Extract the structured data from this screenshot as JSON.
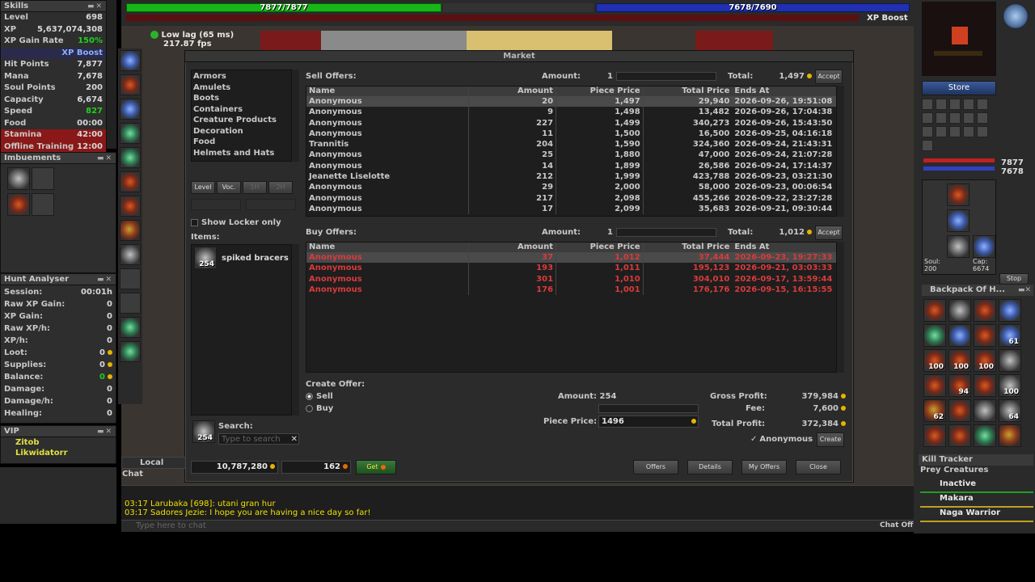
{
  "health_bar": {
    "text": "7877/7877",
    "fill": 1.0
  },
  "mana_bar": {
    "text": "7678/7690",
    "fill": 0.998
  },
  "xp_boost": "XP Boost",
  "lag": {
    "text": "Low lag (65 ms)",
    "fps": "217.87 fps"
  },
  "skills": {
    "title": "Skills",
    "rows": [
      {
        "k": "Level",
        "v": "698"
      },
      {
        "k": "XP",
        "v": "5,637,074,308"
      },
      {
        "k": "XP Gain Rate",
        "v": "150%"
      },
      {
        "k": "",
        "v": "XP Boost"
      },
      {
        "k": "Hit Points",
        "v": "7,877"
      },
      {
        "k": "Mana",
        "v": "7,678"
      },
      {
        "k": "Soul Points",
        "v": "200"
      },
      {
        "k": "Capacity",
        "v": "6,674"
      },
      {
        "k": "Speed",
        "v": "827"
      },
      {
        "k": "Food",
        "v": "00:00"
      },
      {
        "k": "Stamina",
        "v": "42:00"
      },
      {
        "k": "Offline Training",
        "v": "12:00"
      }
    ]
  },
  "imbuements": {
    "title": "Imbuements"
  },
  "hunt": {
    "title": "Hunt Analyser",
    "rows": [
      {
        "k": "Session:",
        "v": "00:01h"
      },
      {
        "k": "Raw XP Gain:",
        "v": "0"
      },
      {
        "k": "XP Gain:",
        "v": "0"
      },
      {
        "k": "Raw XP/h:",
        "v": "0"
      },
      {
        "k": "XP/h:",
        "v": "0"
      },
      {
        "k": "Loot:",
        "v": "0"
      },
      {
        "k": "Supplies:",
        "v": "0"
      },
      {
        "k": "Balance:",
        "v": "0"
      },
      {
        "k": "Damage:",
        "v": "0"
      },
      {
        "k": "Damage/h:",
        "v": "0"
      },
      {
        "k": "Healing:",
        "v": "0"
      }
    ]
  },
  "vip": {
    "title": "VIP",
    "names": [
      "Zitob",
      "Likwidatorr"
    ]
  },
  "market": {
    "title": "Market",
    "categories": [
      "Armors",
      "Amulets",
      "Boots",
      "Containers",
      "Creature Products",
      "Decoration",
      "Food",
      "Helmets and Hats"
    ],
    "filter_buttons": [
      "Level",
      "Voc.",
      "1H",
      "2H"
    ],
    "show_locker": "Show Locker only",
    "items_label": "Items:",
    "item": {
      "name": "spiked bracers",
      "count": "254"
    },
    "search_label": "Search:",
    "search_placeholder": "Type to search",
    "sell": {
      "label": "Sell Offers:",
      "amount_label": "Amount:",
      "amount": "1",
      "total_label": "Total:",
      "total": "1,497",
      "accept": "Accept",
      "headers": [
        "Name",
        "Amount",
        "Piece Price",
        "Total Price",
        "Ends At"
      ],
      "rows": [
        [
          "Anonymous",
          "20",
          "1,497",
          "29,940",
          "2026-09-26, 19:51:08"
        ],
        [
          "Anonymous",
          "9",
          "1,498",
          "13,482",
          "2026-09-26, 17:04:38"
        ],
        [
          "Anonymous",
          "227",
          "1,499",
          "340,273",
          "2026-09-26, 15:43:50"
        ],
        [
          "Anonymous",
          "11",
          "1,500",
          "16,500",
          "2026-09-25, 04:16:18"
        ],
        [
          "Trannitis",
          "204",
          "1,590",
          "324,360",
          "2026-09-24, 21:43:31"
        ],
        [
          "Anonymous",
          "25",
          "1,880",
          "47,000",
          "2026-09-24, 21:07:28"
        ],
        [
          "Anonymous",
          "14",
          "1,899",
          "26,586",
          "2026-09-24, 17:14:37"
        ],
        [
          "Jeanette Liselotte",
          "212",
          "1,999",
          "423,788",
          "2026-09-23, 03:21:30"
        ],
        [
          "Anonymous",
          "29",
          "2,000",
          "58,000",
          "2026-09-23, 00:06:54"
        ],
        [
          "Anonymous",
          "217",
          "2,098",
          "455,266",
          "2026-09-22, 23:27:28"
        ],
        [
          "Anonymous",
          "17",
          "2,099",
          "35,683",
          "2026-09-21, 09:30:44"
        ]
      ]
    },
    "buy": {
      "label": "Buy Offers:",
      "amount_label": "Amount:",
      "amount": "1",
      "total_label": "Total:",
      "total": "1,012",
      "accept": "Accept",
      "headers": [
        "Name",
        "Amount",
        "Piece Price",
        "Total Price",
        "Ends At"
      ],
      "rows": [
        [
          "Anonymous",
          "37",
          "1,012",
          "37,444",
          "2026-09-23, 19:27:33"
        ],
        [
          "Anonymous",
          "193",
          "1,011",
          "195,123",
          "2026-09-21, 03:03:33"
        ],
        [
          "Anonymous",
          "301",
          "1,010",
          "304,010",
          "2026-09-17, 13:59:44"
        ],
        [
          "Anonymous",
          "176",
          "1,001",
          "176,176",
          "2026-09-15, 16:15:55"
        ]
      ]
    },
    "create": {
      "label": "Create Offer:",
      "sell": "Sell",
      "buy": "Buy",
      "amount_label": "Amount:",
      "amount": "254",
      "piece_label": "Piece Price:",
      "piece": "1496",
      "gross_label": "Gross Profit:",
      "gross": "379,984",
      "fee_label": "Fee:",
      "fee": "7,600",
      "total_label": "Total Profit:",
      "total": "372,384",
      "anon": "Anonymous",
      "create_btn": "Create"
    },
    "balance": "10,787,280",
    "coins": "162",
    "get": "Get",
    "footer": [
      "Offers",
      "Details",
      "My Offers",
      "Close"
    ]
  },
  "chat": {
    "tab": "Local Chat",
    "lines": [
      "03:17 Larubaka [698]: utani gran hur",
      "03:17 Sadores Jezie: I hope you are having a nice day so far!"
    ],
    "placeholder": "Type here to chat",
    "off": "Chat Off"
  },
  "right": {
    "store": "Store",
    "hp": "7877",
    "mp": "7678",
    "soul_label": "Soul:",
    "soul": "200",
    "cap_label": "Cap:",
    "cap": "6674",
    "stop": "Stop",
    "backpack": "Backpack Of H...",
    "counts": [
      "100",
      "100",
      "100",
      "61",
      "94",
      "100",
      "62",
      "64"
    ],
    "kill": "Kill Tracker",
    "prey": "Prey Creatures",
    "prey_list": [
      "Inactive",
      "Makara",
      "Naga Warrior"
    ]
  }
}
